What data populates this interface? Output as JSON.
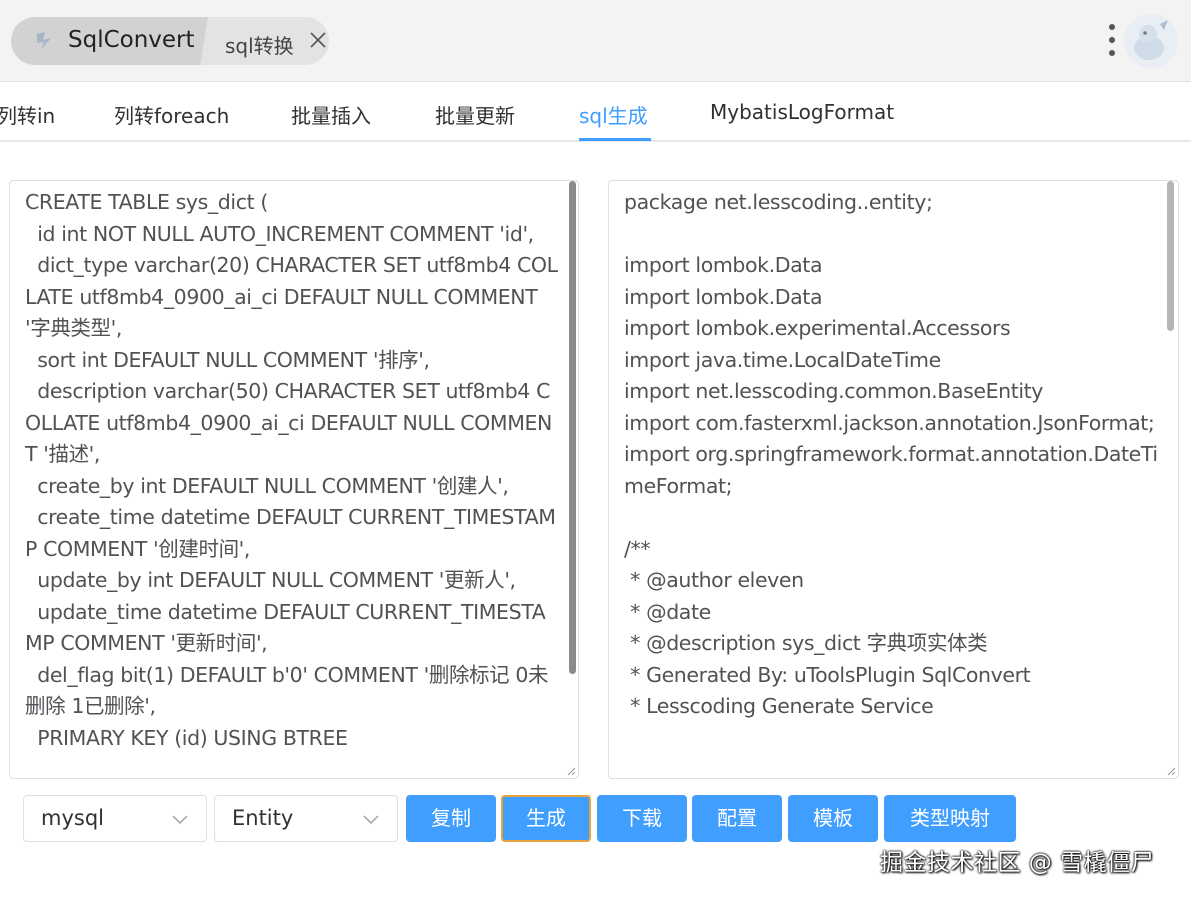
{
  "titlebar": {
    "app_name": "SqlConvert",
    "sub_tab": "sql转换"
  },
  "nav": {
    "tabs": [
      {
        "label": "列转in"
      },
      {
        "label": "列转foreach"
      },
      {
        "label": "批量插入"
      },
      {
        "label": "批量更新"
      },
      {
        "label": "sql生成",
        "active": true
      },
      {
        "label": "MybatisLogFormat"
      }
    ]
  },
  "input_sql": "CREATE TABLE sys_dict (\n  id int NOT NULL AUTO_INCREMENT COMMENT 'id',\n  dict_type varchar(20) CHARACTER SET utf8mb4 COLLATE utf8mb4_0900_ai_ci DEFAULT NULL COMMENT '字典类型',\n  sort int DEFAULT NULL COMMENT '排序',\n  description varchar(50) CHARACTER SET utf8mb4 COLLATE utf8mb4_0900_ai_ci DEFAULT NULL COMMENT '描述',\n  create_by int DEFAULT NULL COMMENT '创建人',\n  create_time datetime DEFAULT CURRENT_TIMESTAMP COMMENT '创建时间',\n  update_by int DEFAULT NULL COMMENT '更新人',\n  update_time datetime DEFAULT CURRENT_TIMESTAMP COMMENT '更新时间',\n  del_flag bit(1) DEFAULT b'0' COMMENT '删除标记 0未删除 1已删除',\n  PRIMARY KEY (id) USING BTREE",
  "output_code": "package net.lesscoding..entity;\n\nimport lombok.Data\nimport lombok.Data\nimport lombok.experimental.Accessors\nimport java.time.LocalDateTime\nimport net.lesscoding.common.BaseEntity\nimport com.fasterxml.jackson.annotation.JsonFormat;\nimport org.springframework.format.annotation.DateTimeFormat;\n\n/**\n * @author eleven\n * @date\n * @description sys_dict 字典项实体类\n * Generated By: uToolsPlugin SqlConvert\n * Lesscoding Generate Service",
  "toolbar": {
    "db_select": "mysql",
    "type_select": "Entity",
    "copy_label": "复制",
    "generate_label": "生成",
    "download_label": "下载",
    "config_label": "配置",
    "template_label": "模板",
    "type_map_label": "类型映射"
  },
  "watermark": "掘金技术社区 @ 雪橇僵尸",
  "colors": {
    "accent": "#409eff",
    "focus_border": "#e6a23c"
  },
  "icons": [
    "app-logo-icon",
    "close-icon",
    "more-vertical-icon",
    "avatar",
    "chevron-down-icon",
    "resize-grip-icon"
  ]
}
